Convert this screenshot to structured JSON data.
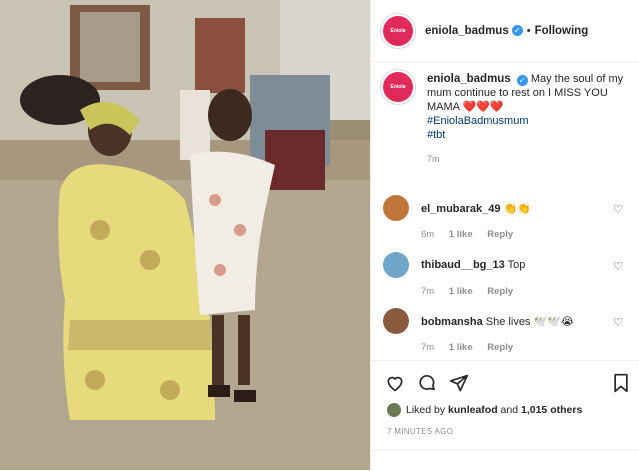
{
  "post": {
    "photo_icon": "vintage-photo-mother-daughter",
    "account": {
      "username": "eniola_badmus",
      "verified": true,
      "follow_state": "Following",
      "avatar_text": "Eniola"
    },
    "caption": {
      "text": "May the soul of my mum continue to rest on I MISS YOU MAMA",
      "emojis": "❤️❤️❤️",
      "hashtags": [
        "#EniolaBadmusmum",
        "#tbt"
      ],
      "time": "7m"
    },
    "comments": [
      {
        "username": "el_mubarak_49",
        "text": "👏👏",
        "time": "6m",
        "likes": "1 like",
        "reply": "Reply"
      },
      {
        "username": "thibaud__bg_13",
        "text": "Top",
        "time": "7m",
        "likes": "1 like",
        "reply": "Reply"
      },
      {
        "username": "bobmansha",
        "text": "She lives 🕊️🕊️😭",
        "time": "7m",
        "likes": "1 like",
        "reply": "Reply"
      }
    ],
    "likes": {
      "prefix": "Liked by",
      "liker": "kunleafod",
      "connector": "and",
      "others": "1,015 others"
    },
    "posted_ago": "7 MINUTES AGO"
  },
  "colors": {
    "brand": "#e02a5c",
    "verified": "#3897f0",
    "hashtag": "#00376b",
    "muted": "#8e8e8e"
  }
}
